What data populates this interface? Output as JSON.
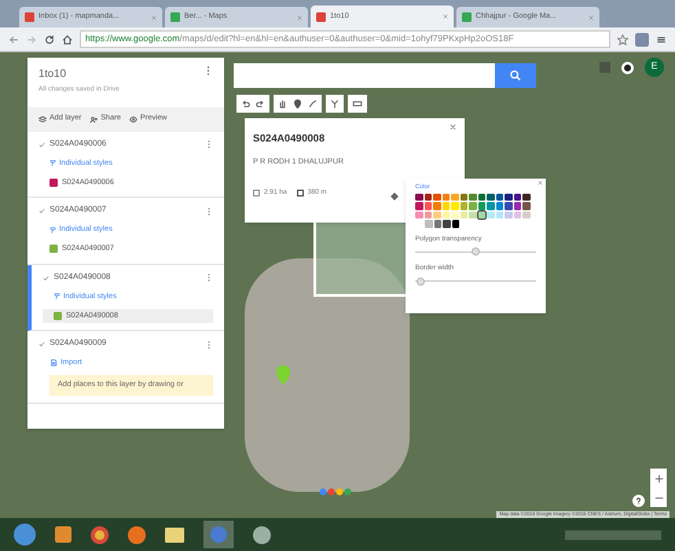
{
  "browser": {
    "tabs": [
      {
        "label": "Inbox (1) - mapmanda...",
        "selected": false,
        "color": "#db4437"
      },
      {
        "label": "Ber... - Maps",
        "selected": false,
        "color": "#34a853"
      },
      {
        "label": "1to10",
        "selected": true,
        "color": "#db4437"
      },
      {
        "label": "Chhajpur - Google Ma...",
        "selected": false,
        "color": "#34a853"
      }
    ],
    "url_host": "https://www.google.com",
    "url_path": "/maps/d/edit?hl=en&hl=en&authuser=0&authuser=0&mid=1ohyf79PKxpHp2oOS18F"
  },
  "avatar": "E",
  "panel": {
    "title": "1to10",
    "subtitle": "All changes saved in Drive",
    "actions": [
      "Add layer",
      "Share",
      "Preview"
    ],
    "layers": [
      {
        "name": "S024A0490006",
        "checked": true,
        "selected": false,
        "style": "Individual styles",
        "feature": "S024A0490006",
        "color": "#c2185b",
        "feature_selected": false
      },
      {
        "name": "S024A0490007",
        "checked": true,
        "selected": false,
        "style": "Individual styles",
        "feature": "S024A0490007",
        "color": "#7cb342",
        "feature_selected": false
      },
      {
        "name": "S024A0490008",
        "checked": true,
        "selected": true,
        "style": "Individual styles",
        "feature": "S024A0490008",
        "color": "#7cb342",
        "feature_selected": true
      },
      {
        "name": "S024A0490009",
        "checked": true,
        "selected": false,
        "import": "Import",
        "hint": "Add places to this layer by drawing or"
      }
    ]
  },
  "popup": {
    "title": "S024A0490008",
    "description": "P R RODH 1 DHALUJPUR",
    "area": "2.91 ha",
    "perimeter": "380 m"
  },
  "style_panel": {
    "color_label": "Color",
    "swatch_rows": [
      [
        {
          "color": "#880e4f",
          "selected": false
        },
        {
          "color": "#a52714",
          "selected": false
        },
        {
          "color": "#e65100",
          "selected": false
        },
        {
          "color": "#f57f17",
          "selected": false
        },
        {
          "color": "#f9a825",
          "selected": false
        },
        {
          "color": "#817717",
          "selected": false
        },
        {
          "color": "#558b2f",
          "selected": false
        },
        {
          "color": "#097138",
          "selected": false
        },
        {
          "color": "#006064",
          "selected": false
        },
        {
          "color": "#01579b",
          "selected": false
        },
        {
          "color": "#1a237e",
          "selected": false
        },
        {
          "color": "#4a148c",
          "selected": false
        },
        {
          "color": "#3e2723",
          "selected": false
        }
      ],
      [
        {
          "color": "#c2185b",
          "selected": false
        },
        {
          "color": "#ff5252",
          "selected": false
        },
        {
          "color": "#f57c00",
          "selected": false
        },
        {
          "color": "#ffd600",
          "selected": false
        },
        {
          "color": "#ffea00",
          "selected": false
        },
        {
          "color": "#afb42b",
          "selected": false
        },
        {
          "color": "#7cb342",
          "selected": false
        },
        {
          "color": "#0f9d58",
          "selected": false
        },
        {
          "color": "#0097a7",
          "selected": false
        },
        {
          "color": "#0288d1",
          "selected": false
        },
        {
          "color": "#3949ab",
          "selected": false
        },
        {
          "color": "#9c27b0",
          "selected": false
        },
        {
          "color": "#795548",
          "selected": false
        }
      ],
      [
        {
          "color": "#f48fb1",
          "selected": false
        },
        {
          "color": "#ef9a9a",
          "selected": false
        },
        {
          "color": "#ffcc80",
          "selected": false
        },
        {
          "color": "#fff59d",
          "selected": false
        },
        {
          "color": "#fff9c4",
          "selected": false
        },
        {
          "color": "#e6ee9c",
          "selected": false
        },
        {
          "color": "#c5e1a5",
          "selected": false
        },
        {
          "color": "#a5d6a7",
          "selected": true
        },
        {
          "color": "#b2ebf2",
          "selected": false
        },
        {
          "color": "#b3e5fc",
          "selected": false
        },
        {
          "color": "#c5cae9",
          "selected": false
        },
        {
          "color": "#e1bee7",
          "selected": false
        },
        {
          "color": "#d7ccc8",
          "selected": false
        }
      ],
      [
        {
          "color": "#bdbdbd",
          "selected": false
        },
        {
          "color": "#757575",
          "selected": false
        },
        {
          "color": "#424242",
          "selected": false
        },
        {
          "color": "#000000",
          "selected": false
        }
      ]
    ],
    "transparency_label": "Polygon transparency",
    "transparency": {
      "level": 0.5
    },
    "border_label": "Border width",
    "border": {
      "level": 0.05
    }
  },
  "attribution": "Map data ©2016 Google Imagery ©2016 CNES / Astrium, DigitalGlobe | Terms"
}
